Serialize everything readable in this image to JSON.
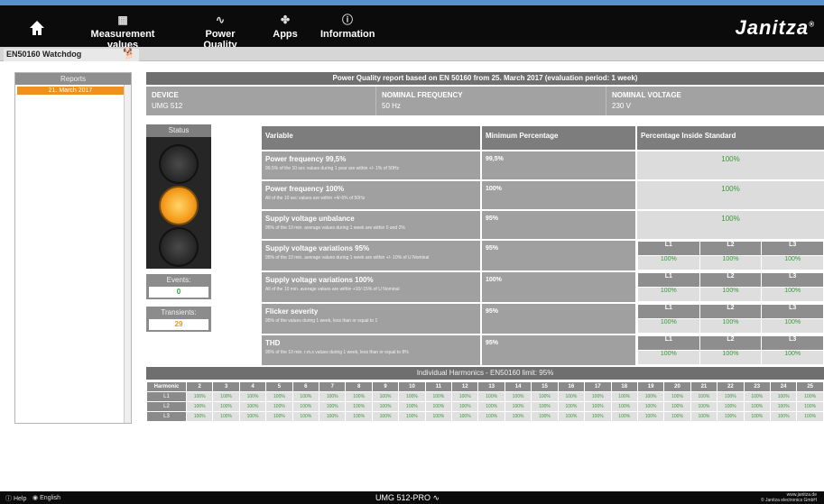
{
  "nav": {
    "home_icon": "home-icon",
    "items": [
      {
        "label": "Measurement values",
        "icon": "gauge-icon"
      },
      {
        "label": "Power Quality",
        "icon": "waveform-icon"
      },
      {
        "label": "Apps",
        "icon": "apps-icon"
      },
      {
        "label": "Information",
        "icon": "info-icon"
      }
    ],
    "brand": "Janitza",
    "brand_mark": "®"
  },
  "subbar": {
    "watchdog_label": "EN50160 Watchdog",
    "dog_icon": "dog-icon"
  },
  "reports": {
    "header": "Reports",
    "items": [
      "21. March 2017"
    ]
  },
  "report": {
    "title": "Power Quality report based on EN 50160 from 25. March 2017 (evaluation period: 1 week)",
    "device_label": "DEVICE",
    "device_value": "UMG 512",
    "freq_label": "NOMINAL FREQUENCY",
    "freq_value": "50 Hz",
    "voltage_label": "NOMINAL VOLTAGE",
    "voltage_value": "230 V"
  },
  "status": {
    "header": "Status",
    "active_lamp": "yellow",
    "events_label": "Events:",
    "events_value": "0",
    "transients_label": "Transients:",
    "transients_value": "29"
  },
  "table": {
    "headers": [
      "Variable",
      "Minimum Percentage",
      "Percentage Inside Standard"
    ],
    "rows": [
      {
        "name": "Power frequency 99,5%",
        "desc": "99.5% of the 10 sec values during 1 year are within +/- 1% of 50Hz",
        "min": "99,5%",
        "pct": "100%"
      },
      {
        "name": "Power frequency 100%",
        "desc": "All of the 10 sec values are within +4/-6% of 50Hz",
        "min": "100%",
        "pct": "100%"
      },
      {
        "name": "Supply voltage unbalance",
        "desc": "95% of the 10 min. average values during 1 week are within 0 and 2%",
        "min": "95%",
        "pct": "100%"
      },
      {
        "name": "Supply voltage variations 95%",
        "desc": "95% of the 10 min. average values during 1 week are within +/- 10% of U Nominal",
        "min": "95%",
        "phases": [
          "L1",
          "L2",
          "L3"
        ],
        "values": [
          "100%",
          "100%",
          "100%"
        ]
      },
      {
        "name": "Supply voltage variations 100%",
        "desc": "All of the 10 min. average values are within +10/-15% of U Nominal",
        "min": "100%",
        "phases": [
          "L1",
          "L2",
          "L3"
        ],
        "values": [
          "100%",
          "100%",
          "100%"
        ]
      },
      {
        "name": "Flicker severity",
        "desc": "95% of the values during 1 week, less than or equal to 1",
        "min": "95%",
        "phases": [
          "L1",
          "L2",
          "L3"
        ],
        "values": [
          "100%",
          "100%",
          "100%"
        ]
      },
      {
        "name": "THD",
        "desc": "95% of the 10 min. r.m.s values during 1 week, less than or equal to 8%",
        "min": "95%",
        "phases": [
          "L1",
          "L2",
          "L3"
        ],
        "values": [
          "100%",
          "100%",
          "100%"
        ]
      }
    ]
  },
  "harmonics": {
    "title": "Individual Harmonics - EN50160 limit: 95%",
    "header_label": "Harmonic",
    "orders": [
      "2",
      "3",
      "4",
      "5",
      "6",
      "7",
      "8",
      "9",
      "10",
      "11",
      "12",
      "13",
      "14",
      "15",
      "16",
      "17",
      "18",
      "19",
      "20",
      "21",
      "22",
      "23",
      "24",
      "25"
    ],
    "rows": [
      {
        "label": "L1",
        "value": "100%"
      },
      {
        "label": "L2",
        "value": "100%"
      },
      {
        "label": "L3",
        "value": "100%"
      }
    ]
  },
  "footer": {
    "help": "Help",
    "language": "English",
    "model": "UMG 512-PRO",
    "site_line1": "www.janitza.de",
    "site_line2": "© Janitza electronics GmbH"
  }
}
